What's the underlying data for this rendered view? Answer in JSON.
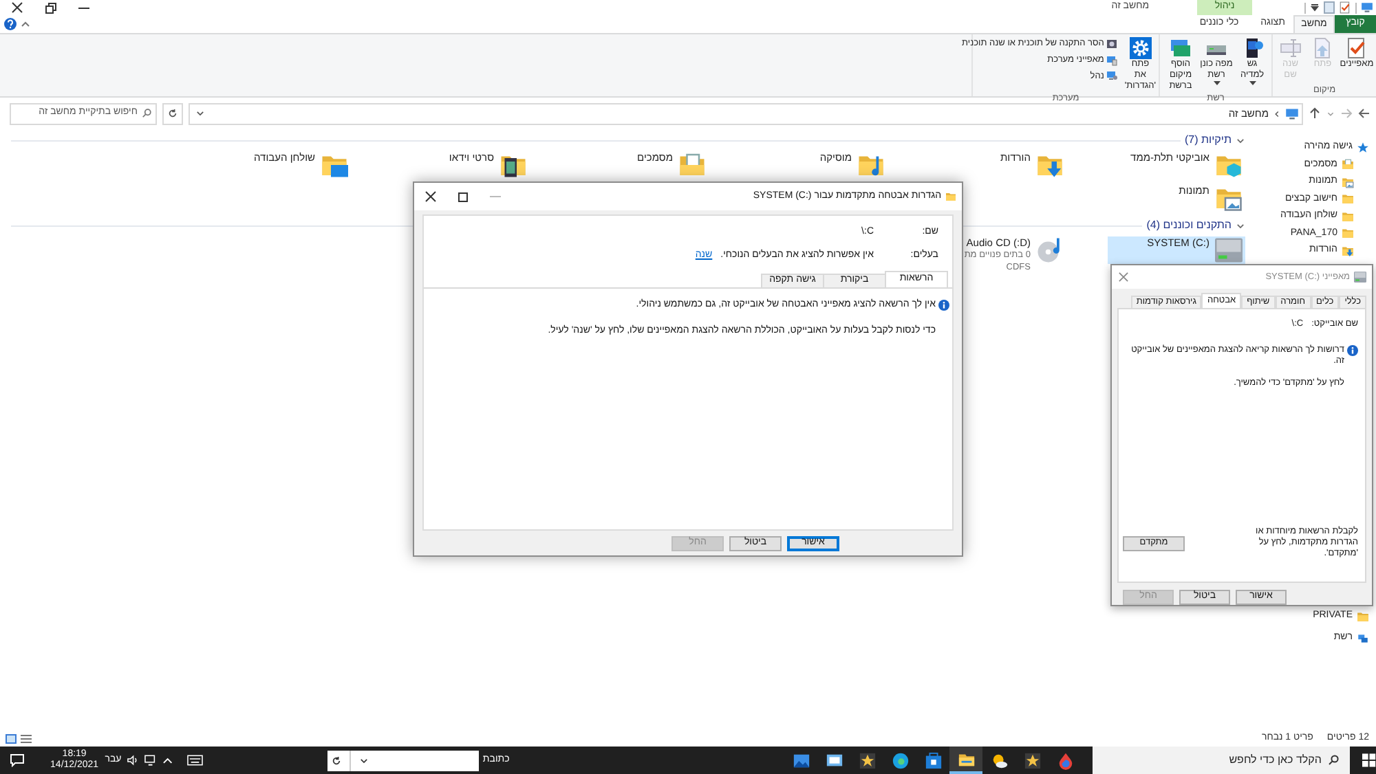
{
  "window": {
    "title": "מחשב זה",
    "contextual_group": "ניהול"
  },
  "ribbon_tabs": [
    {
      "label": "קובץ",
      "kind": "file",
      "selected": false
    },
    {
      "label": "מחשב",
      "kind": "tab",
      "selected": true
    },
    {
      "label": "תצוגה",
      "kind": "tab",
      "selected": false
    },
    {
      "label": "כלי כוננים",
      "kind": "contextual",
      "selected": false
    }
  ],
  "ribbon_groups": [
    {
      "label": "מיקום",
      "buttons": [
        {
          "label": "מאפיינים",
          "kind": "properties",
          "disabled": false,
          "dropdown": false
        },
        {
          "label": "פתח",
          "kind": "open",
          "disabled": true,
          "dropdown": false
        },
        {
          "label": "שנה שם",
          "kind": "rename",
          "disabled": true,
          "dropdown": false
        }
      ]
    },
    {
      "label": "רשת",
      "buttons": [
        {
          "label": "גש למדיה",
          "kind": "media",
          "disabled": false,
          "dropdown": true
        },
        {
          "label": "מפה כונן רשת",
          "kind": "map-drive",
          "disabled": false,
          "dropdown": true
        },
        {
          "label": "הוסף מיקום ברשת",
          "kind": "network-location",
          "disabled": false,
          "dropdown": false
        }
      ]
    },
    {
      "label": "מערכת",
      "buttons": [
        {
          "label": "פתח את 'הגדרות'",
          "kind": "settings",
          "disabled": false,
          "dropdown": false
        }
      ],
      "small_buttons": [
        {
          "label": "הסר התקנה של תוכנית או שנה תוכנית",
          "kind": "uninstall"
        },
        {
          "label": "מאפייני מערכת",
          "kind": "system"
        },
        {
          "label": "נהל",
          "kind": "manage"
        }
      ]
    }
  ],
  "address_bar": {
    "path": "מחשב זה",
    "search_placeholder": "חיפוש בתיקיית מחשב זה"
  },
  "navigation_pane": {
    "items": [
      {
        "label": "גישה מהירה",
        "kind": "star",
        "children": [
          {
            "label": "מסמכים",
            "kind": "documents"
          },
          {
            "label": "תמונות",
            "kind": "pictures"
          },
          {
            "label": "חישוב קבצים",
            "kind": "folder"
          },
          {
            "label": "שולחן העבודה",
            "kind": "folder"
          },
          {
            "label": "PANA_170",
            "kind": "folder"
          },
          {
            "label": "הורדות",
            "kind": "downloads"
          }
        ]
      }
    ],
    "bottom_items": [
      {
        "label": "PRIVATE",
        "kind": "folder"
      },
      {
        "label": "רשת",
        "kind": "network"
      }
    ]
  },
  "sections": [
    {
      "title": "תיקיות (7)",
      "expanded": true,
      "items": [
        {
          "name": "אוביקטי תלת-ממד",
          "kind": "objects3d",
          "selected": false
        },
        {
          "name": "הורדות",
          "kind": "downloads",
          "selected": false
        },
        {
          "name": "מוסיקה",
          "kind": "music",
          "selected": false
        },
        {
          "name": "מסמכים",
          "kind": "documents",
          "selected": false
        },
        {
          "name": "סרטי וידאו",
          "kind": "video",
          "selected": false
        },
        {
          "name": "שולחן העבודה",
          "kind": "desktop",
          "selected": false
        },
        {
          "name": "תמונות",
          "kind": "pictures",
          "selected": false
        }
      ]
    },
    {
      "title": "התקנים וכוננים (4)",
      "expanded": true,
      "items": [
        {
          "name": "SYSTEM (C:)",
          "kind": "drive",
          "selected": true
        },
        {
          "name": "(D:) Audio CD",
          "kind": "cd",
          "selected": false,
          "details": [
            "0 בתים פנויים מת",
            "CDFS"
          ]
        }
      ]
    }
  ],
  "status_bar": {
    "count": "12 פריטים",
    "selection": "פריט 1 נבחר"
  },
  "advanced_dialog": {
    "title": "הגדרות אבטחה מתקדמות עבור SYSTEM (C:)",
    "fields": [
      {
        "label": "שם:",
        "value": "C:\\"
      },
      {
        "label": "בעלים:",
        "value": "אין אפשרות להציג את הבעלים הנוכחי.",
        "link": "שנה"
      }
    ],
    "tabs": [
      {
        "label": "הרשאות",
        "selected": true
      },
      {
        "label": "ביקורת",
        "selected": false
      },
      {
        "label": "גישה תקפה",
        "selected": false
      }
    ],
    "message": "אין לך הרשאה להציג מאפייני האבטחה של אובייקט זה, גם כמשתמש ניהולי.",
    "hint": "כדי לנסות לקבל בעלות על האובייקט, הכוללת הרשאה להצגת המאפיינים שלו, לחץ על 'שנה' לעיל.",
    "buttons": [
      {
        "label": "אישור",
        "default": true,
        "disabled": false
      },
      {
        "label": "ביטול",
        "default": false,
        "disabled": false
      },
      {
        "label": "החל",
        "default": false,
        "disabled": true
      }
    ]
  },
  "properties_dialog": {
    "title": "מאפייני SYSTEM (C:)",
    "tabs": [
      {
        "label": "כללי",
        "selected": false
      },
      {
        "label": "כלים",
        "selected": false
      },
      {
        "label": "חומרה",
        "selected": false
      },
      {
        "label": "שיתוף",
        "selected": false
      },
      {
        "label": "אבטחה",
        "selected": true
      },
      {
        "label": "גירסאות קודמות",
        "selected": false
      }
    ],
    "object_name_label": "שם אובייקט:",
    "object_name": "C:\\",
    "message": "דרושות לך הרשאות קריאה להצגת המאפיינים של אובייקט זה.",
    "hint": "לחץ על 'מתקדם' כדי להמשיך.",
    "advanced_text": "לקבלת הרשאות מיוחדות או הגדרות מתקדמות, לחץ על 'מתקדם'.",
    "advanced_button": "מתקדם",
    "buttons": [
      {
        "label": "אישור",
        "default": false,
        "disabled": false
      },
      {
        "label": "ביטול",
        "default": false,
        "disabled": false
      },
      {
        "label": "החל",
        "default": false,
        "disabled": true
      }
    ]
  },
  "taskbar": {
    "search_placeholder": "הקלד כאן כדי לחפש",
    "apps": [
      {
        "kind": "photos",
        "active": false
      },
      {
        "kind": "screen",
        "active": false
      },
      {
        "kind": "star",
        "active": false
      },
      {
        "kind": "browser",
        "active": false
      },
      {
        "kind": "store",
        "active": false
      },
      {
        "kind": "folder",
        "active": true
      },
      {
        "kind": "weather",
        "active": false
      },
      {
        "kind": "star",
        "active": false
      },
      {
        "kind": "drop",
        "active": false
      }
    ],
    "address_label": "כתובת",
    "language": "עבר",
    "time": "18:19",
    "date": "14/12/2021"
  }
}
